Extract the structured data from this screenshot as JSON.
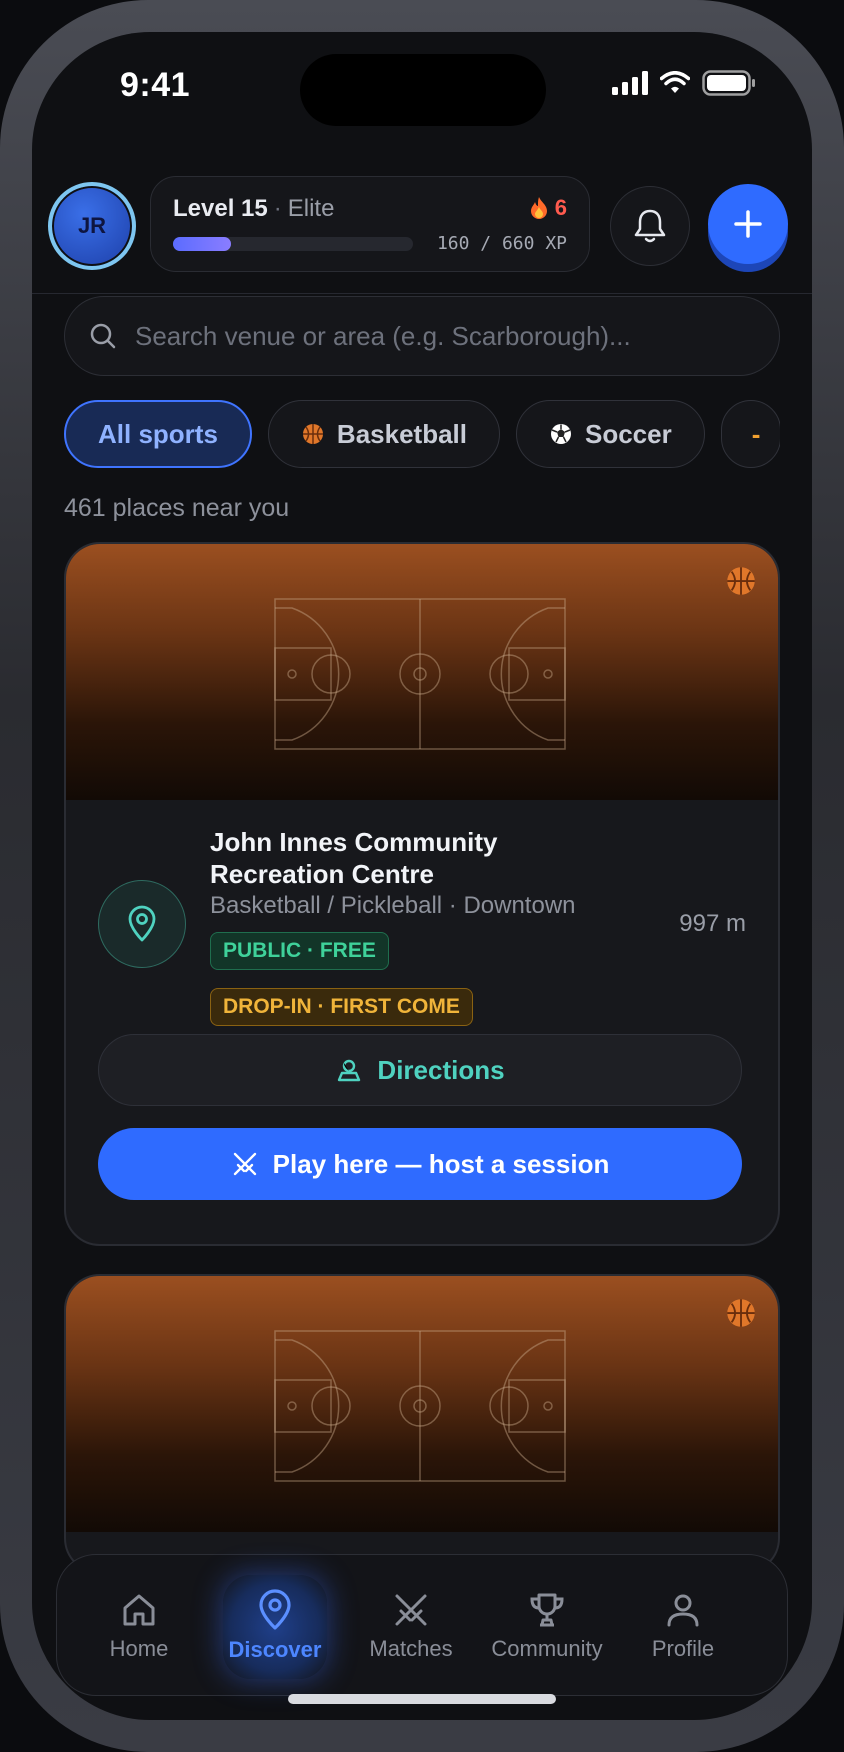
{
  "status_bar": {
    "time": "9:41"
  },
  "user": {
    "initials": "JR"
  },
  "level": {
    "label": "Level 15",
    "tier": "Elite",
    "streak": "6",
    "xp_text": "160 / 660 XP",
    "xp_fraction": 0.24
  },
  "search": {
    "placeholder": "Search venue or area (e.g. Scarborough)..."
  },
  "filters": [
    {
      "label": "All sports",
      "active": true
    },
    {
      "label": "Basketball",
      "icon": "basketball-icon"
    },
    {
      "label": "Soccer",
      "icon": "soccer-icon"
    }
  ],
  "results_count": "461 places near you",
  "venues": [
    {
      "name": "John Innes Community Recreation Centre",
      "sports_area": "Basketball / Pickleball · Downtown",
      "distance": "997 m",
      "tags": [
        "PUBLIC · FREE",
        "DROP-IN · FIRST COME"
      ],
      "directions_label": "Directions",
      "play_label": "Play here — host a session"
    }
  ],
  "tabbar": [
    {
      "label": "Home",
      "icon": "home-icon"
    },
    {
      "label": "Discover",
      "icon": "map-pin-icon",
      "active": true
    },
    {
      "label": "Matches",
      "icon": "crossed-swords-icon"
    },
    {
      "label": "Community",
      "icon": "trophy-icon"
    },
    {
      "label": "Profile",
      "icon": "user-icon"
    }
  ],
  "colors": {
    "accent": "#2f6bff",
    "teal": "#4fd2c0",
    "green": "#3fd19a",
    "amber": "#f0b43a",
    "streak": "#ff5a4e"
  }
}
